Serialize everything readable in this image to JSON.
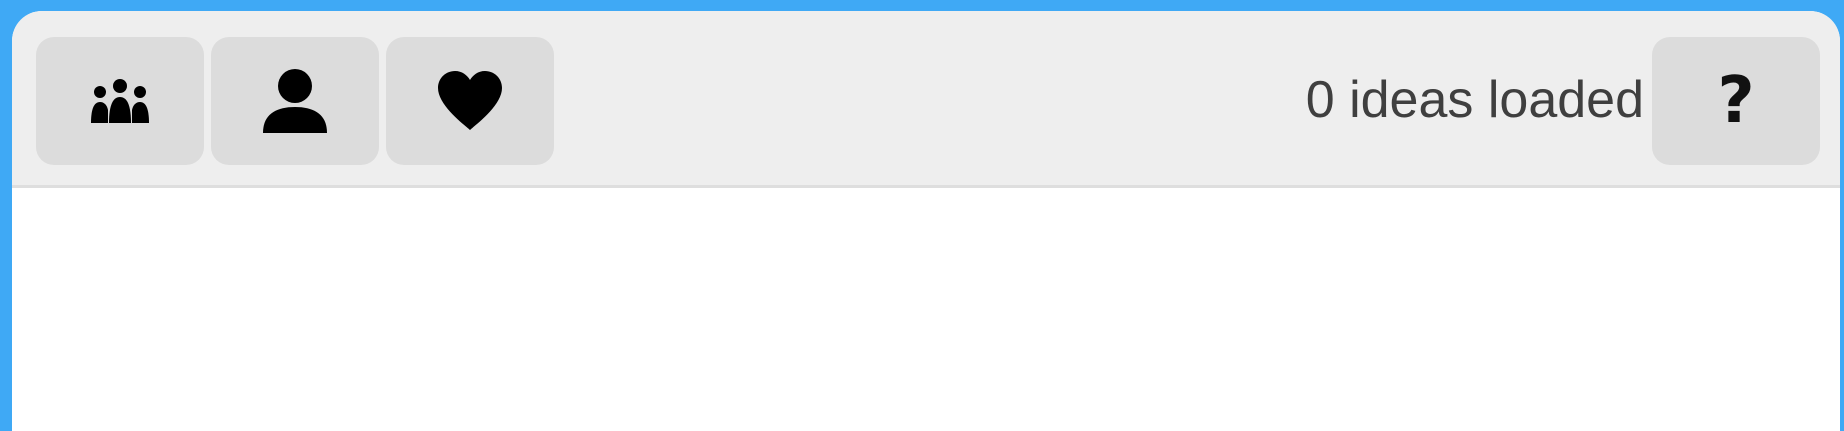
{
  "toolbar": {
    "buttons": [
      {
        "id": "groups",
        "icon": "group-icon"
      },
      {
        "id": "user",
        "icon": "user-icon"
      },
      {
        "id": "favorites",
        "icon": "heart-icon"
      }
    ],
    "status_text": "0 ideas loaded",
    "help_label": "?"
  },
  "colors": {
    "background": "#3fa9f5",
    "toolbar": "#eeeeee",
    "button": "#dcdcdc",
    "text": "#3f3f3f"
  }
}
